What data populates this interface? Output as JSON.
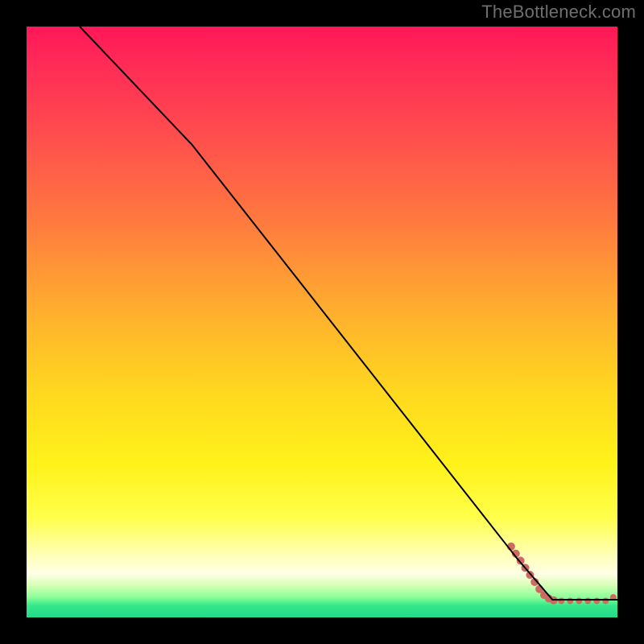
{
  "watermark": "TheBottleneck.com",
  "chart_data": {
    "type": "line",
    "title": "",
    "xlabel": "",
    "ylabel": "",
    "xlim": [
      0,
      100
    ],
    "ylim": [
      0,
      100
    ],
    "main_curve": {
      "name": "curve",
      "color": "#000000",
      "points": [
        {
          "x": 9,
          "y": 100
        },
        {
          "x": 28,
          "y": 80
        },
        {
          "x": 83,
          "y": 10
        },
        {
          "x": 89,
          "y": 3
        },
        {
          "x": 100,
          "y": 3
        }
      ]
    },
    "markers": {
      "name": "bottom-dots",
      "color": "#cf6a63",
      "points": [
        {
          "x": 82.0,
          "y": 12.0,
          "r": 5
        },
        {
          "x": 82.8,
          "y": 10.8,
          "r": 5
        },
        {
          "x": 83.6,
          "y": 9.6,
          "r": 5
        },
        {
          "x": 84.4,
          "y": 8.4,
          "r": 5
        },
        {
          "x": 85.2,
          "y": 7.2,
          "r": 5
        },
        {
          "x": 86.0,
          "y": 6.0,
          "r": 5
        },
        {
          "x": 86.8,
          "y": 4.8,
          "r": 5
        },
        {
          "x": 87.6,
          "y": 3.8,
          "r": 5
        },
        {
          "x": 88.4,
          "y": 3.2,
          "r": 5
        },
        {
          "x": 89.2,
          "y": 2.9,
          "r": 5
        },
        {
          "x": 90.5,
          "y": 2.8,
          "r": 4
        },
        {
          "x": 92.0,
          "y": 2.8,
          "r": 4
        },
        {
          "x": 93.5,
          "y": 2.8,
          "r": 4
        },
        {
          "x": 95.0,
          "y": 2.8,
          "r": 4
        },
        {
          "x": 96.5,
          "y": 2.8,
          "r": 4
        },
        {
          "x": 98.0,
          "y": 2.8,
          "r": 4
        },
        {
          "x": 99.3,
          "y": 3.4,
          "r": 4
        }
      ]
    }
  }
}
